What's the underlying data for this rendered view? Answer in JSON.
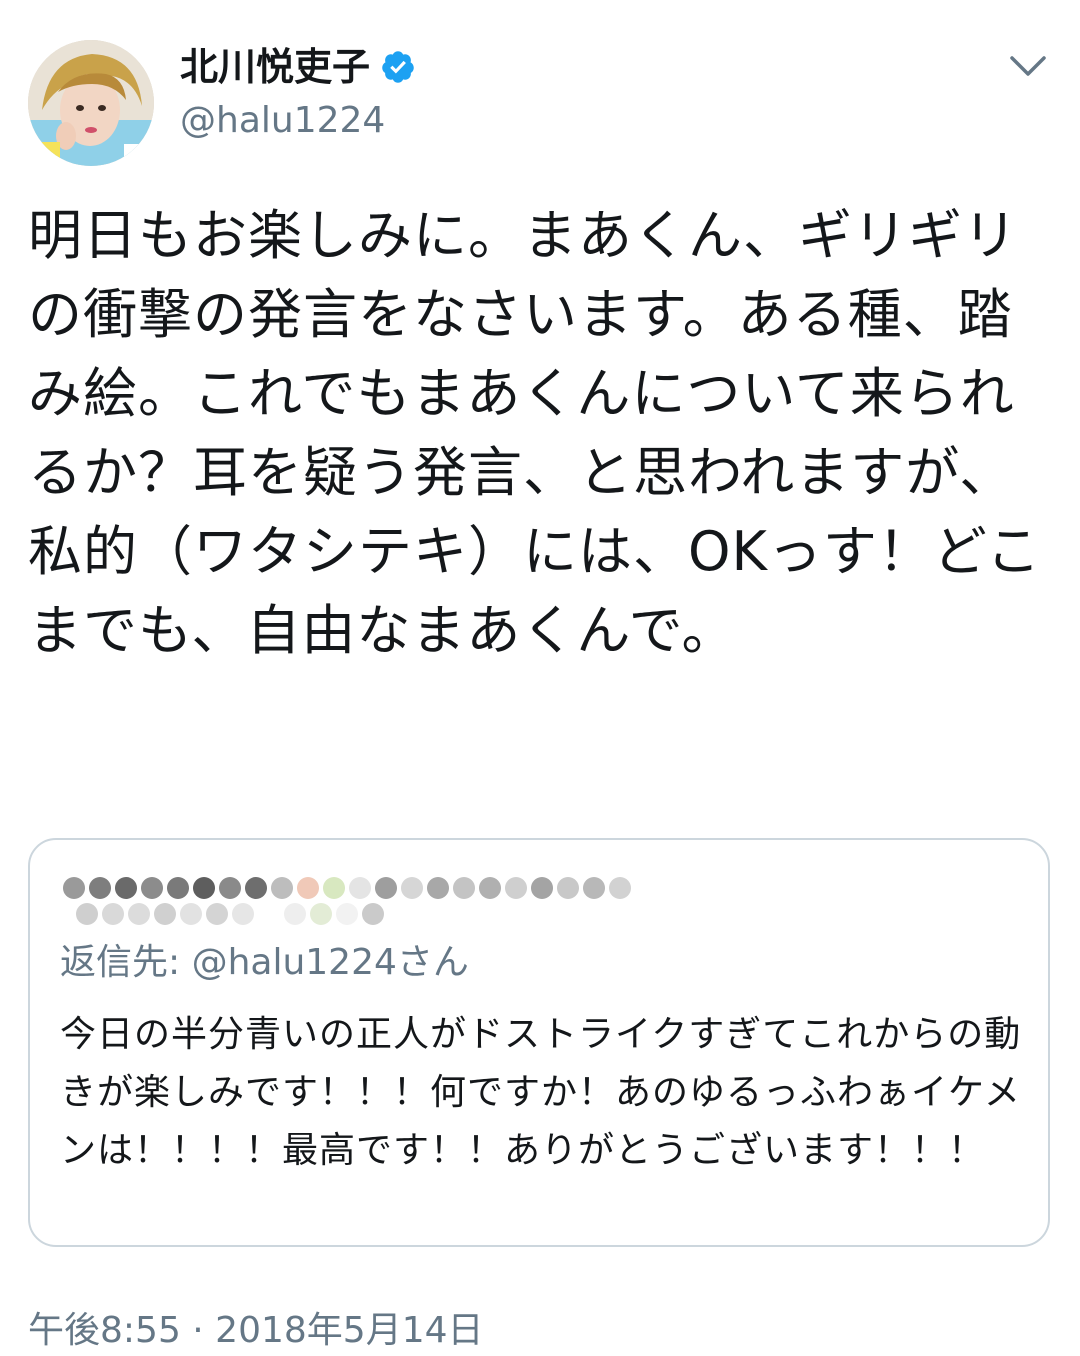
{
  "tweet": {
    "display_name": "北川悦吏子",
    "handle": "@halu1224",
    "verified": true,
    "avatar_icon": "profile-photo",
    "text": "明日もお楽しみに。まあくん、ギリギリの衝撃の発言をなさいます。ある種、踏み絵。これでもまあくんについて来られるか？耳を疑う発言、と思われますが、私的（ワタシテキ）には、OKっす！どこまでも、自由なまあくんで。",
    "timestamp": "午後8:55 · 2018年5月14日"
  },
  "quoted_tweet": {
    "author": "",
    "author_pixelated": true,
    "reply_to": "返信先: @halu1224さん",
    "text": "今日の半分青いの正人がドストライクすぎてこれからの動きが楽しみです！！！何ですか！あのゆるっふわぁイケメンは！！！！最高です！！ありがとうございます！！！"
  },
  "colors": {
    "text": "#14171a",
    "secondary": "#657786",
    "verified_blue": "#1da1f2",
    "border": "#ccd6dd"
  },
  "icons": {
    "verified": "verified-badge-icon",
    "menu": "chevron-down-icon"
  }
}
